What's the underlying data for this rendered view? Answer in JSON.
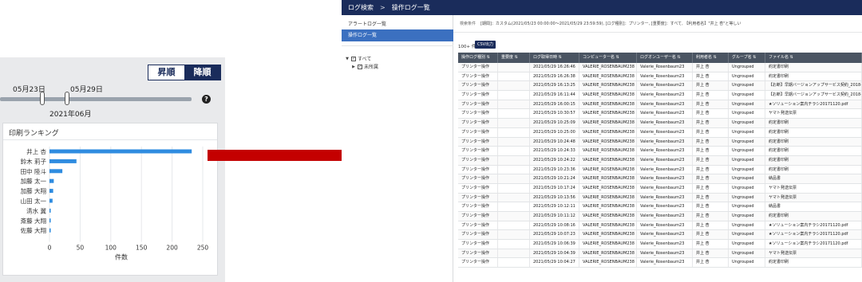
{
  "left": {
    "sort": {
      "asc_label": "昇順",
      "desc_label": "降順"
    },
    "slider": {
      "start_label": "05月23日",
      "end_label": "05月29日",
      "month_label": "2021年06月"
    },
    "help_icon": "question-circle-icon",
    "ranking": {
      "title": "印刷ランキング"
    }
  },
  "chart_data": {
    "type": "bar",
    "title": "",
    "xlabel": "件数",
    "ylabel": "",
    "categories": [
      "井上 杏",
      "鈴木 莉子",
      "田中 陸斗",
      "加藤 太一",
      "加藤 大翔",
      "山田 太一",
      "清水 翼",
      "斎藤 大翔",
      "佐藤 大翔"
    ],
    "values": [
      232,
      44,
      21,
      7,
      6,
      5,
      2,
      2,
      2
    ],
    "xlim": [
      0,
      250
    ],
    "xticks": [
      0,
      50,
      100,
      150,
      200,
      250
    ],
    "orientation": "horizontal",
    "grid": true,
    "bar_color": "#2f8ce0"
  },
  "app": {
    "breadcrumb": {
      "root": "ログ検索",
      "separator": ">",
      "current": "操作ログ一覧"
    },
    "side": {
      "items": [
        "アラートログ一覧",
        "操作ログ一覧"
      ],
      "tree": {
        "all": "すべて",
        "child": "未所属"
      }
    },
    "conditions": {
      "label": "検索条件",
      "text": "[期間]：カスタム(2021/05/23 00:00:00～2021/05/29 23:59:59), [ログ種別]：プリンター, [重要度]：すべて, 【利用者名】\"井上 杏\"と等しい"
    },
    "count": "100+ 件",
    "csv_label": "CSV出力",
    "columns": [
      "操作ログ種別 ⇅",
      "重要度 ⇅",
      "ログ取得日時 ⇅",
      "コンピューター名 ⇅",
      "ログオンユーザー名 ⇅",
      "利用者名 ⇅",
      "グループ名 ⇅",
      "ファイル名 ⇅"
    ],
    "rows": [
      [
        "プリンター操作",
        "",
        "2021/05/29 16:26:46",
        "VALERIE_ROSENBAUM238",
        "Valerie_Rosenbaum23",
        "井上 杏",
        "Ungrouped",
        "約定書印刷"
      ],
      [
        "プリンター操作",
        "",
        "2021/05/29 16:26:38",
        "VALERIE_ROSENBAUM238",
        "Valerie_Rosenbaum23",
        "井上 杏",
        "Ungrouped",
        "約定書印刷"
      ],
      [
        "プリンター操作",
        "",
        "2021/05/29 16:13:25",
        "VALERIE_ROSENBAUM238",
        "Valerie_Rosenbaum23",
        "井上 杏",
        "Ungrouped",
        "【お断】早期バージョンアップサービス契約_2018-"
      ],
      [
        "プリンター操作",
        "",
        "2021/05/29 16:11:44",
        "VALERIE_ROSENBAUM238",
        "Valerie_Rosenbaum23",
        "井上 杏",
        "Ungrouped",
        "【お断】早期バージョンアップサービス契約_2018-"
      ],
      [
        "プリンター操作",
        "",
        "2021/05/29 16:00:15",
        "VALERIE_ROSENBAUM238",
        "Valerie_Rosenbaum23",
        "井上 杏",
        "Ungrouped",
        "★ソリューション案内チラシ20171120.pdf"
      ],
      [
        "プリンター操作",
        "",
        "2021/05/29 10:30:57",
        "VALERIE_ROSENBAUM238",
        "Valerie_Rosenbaum23",
        "井上 杏",
        "Ungrouped",
        "ヤマト発送伝票"
      ],
      [
        "プリンター操作",
        "",
        "2021/05/29 10:25:09",
        "VALERIE_ROSENBAUM238",
        "Valerie_Rosenbaum23",
        "井上 杏",
        "Ungrouped",
        "約定書印刷"
      ],
      [
        "プリンター操作",
        "",
        "2021/05/29 10:25:00",
        "VALERIE_ROSENBAUM238",
        "Valerie_Rosenbaum23",
        "井上 杏",
        "Ungrouped",
        "約定書印刷"
      ],
      [
        "プリンター操作",
        "",
        "2021/05/29 10:24:48",
        "VALERIE_ROSENBAUM238",
        "Valerie_Rosenbaum23",
        "井上 杏",
        "Ungrouped",
        "約定書印刷"
      ],
      [
        "プリンター操作",
        "",
        "2021/05/29 10:24:33",
        "VALERIE_ROSENBAUM238",
        "Valerie_Rosenbaum23",
        "井上 杏",
        "Ungrouped",
        "約定書印刷"
      ],
      [
        "プリンター操作",
        "",
        "2021/05/29 10:24:22",
        "VALERIE_ROSENBAUM238",
        "Valerie_Rosenbaum23",
        "井上 杏",
        "Ungrouped",
        "約定書印刷"
      ],
      [
        "プリンター操作",
        "",
        "2021/05/29 10:23:36",
        "VALERIE_ROSENBAUM238",
        "Valerie_Rosenbaum23",
        "井上 杏",
        "Ungrouped",
        "約定書印刷"
      ],
      [
        "プリンター操作",
        "",
        "2021/05/29 10:21:24",
        "VALERIE_ROSENBAUM238",
        "Valerie_Rosenbaum23",
        "井上 杏",
        "Ungrouped",
        "納品書"
      ],
      [
        "プリンター操作",
        "",
        "2021/05/29 10:17:24",
        "VALERIE_ROSENBAUM238",
        "Valerie_Rosenbaum23",
        "井上 杏",
        "Ungrouped",
        "ヤマト発送伝票"
      ],
      [
        "プリンター操作",
        "",
        "2021/05/29 10:13:56",
        "VALERIE_ROSENBAUM238",
        "Valerie_Rosenbaum23",
        "井上 杏",
        "Ungrouped",
        "ヤマト発送伝票"
      ],
      [
        "プリンター操作",
        "",
        "2021/05/29 10:12:11",
        "VALERIE_ROSENBAUM238",
        "Valerie_Rosenbaum23",
        "井上 杏",
        "Ungrouped",
        "納品書"
      ],
      [
        "プリンター操作",
        "",
        "2021/05/29 10:11:12",
        "VALERIE_ROSENBAUM238",
        "Valerie_Rosenbaum23",
        "井上 杏",
        "Ungrouped",
        "約定書印刷"
      ],
      [
        "プリンター操作",
        "",
        "2021/05/29 10:08:16",
        "VALERIE_ROSENBAUM238",
        "Valerie_Rosenbaum23",
        "井上 杏",
        "Ungrouped",
        "★ソリューション案内チラシ20171120.pdf"
      ],
      [
        "プリンター操作",
        "",
        "2021/05/29 10:07:23",
        "VALERIE_ROSENBAUM238",
        "Valerie_Rosenbaum23",
        "井上 杏",
        "Ungrouped",
        "★ソリューション案内チラシ20171120.pdf"
      ],
      [
        "プリンター操作",
        "",
        "2021/05/29 10:06:39",
        "VALERIE_ROSENBAUM238",
        "Valerie_Rosenbaum23",
        "井上 杏",
        "Ungrouped",
        "★ソリューション案内チラシ20171120.pdf"
      ],
      [
        "プリンター操作",
        "",
        "2021/05/29 10:04:39",
        "VALERIE_ROSENBAUM238",
        "Valerie_Rosenbaum23",
        "井上 杏",
        "Ungrouped",
        "ヤマト発送伝票"
      ],
      [
        "プリンター操作",
        "",
        "2021/05/29 10:04:27",
        "VALERIE_ROSENBAUM238",
        "Valerie_Rosenbaum23",
        "井上 杏",
        "Ungrouped",
        "約定書印刷"
      ]
    ]
  },
  "colors": {
    "header_navy": "#1a2c5b",
    "selected_blue": "#3b70c0",
    "arrow_red": "#c40000",
    "bar_blue": "#2f8ce0",
    "grid_header": "#4a5462"
  }
}
